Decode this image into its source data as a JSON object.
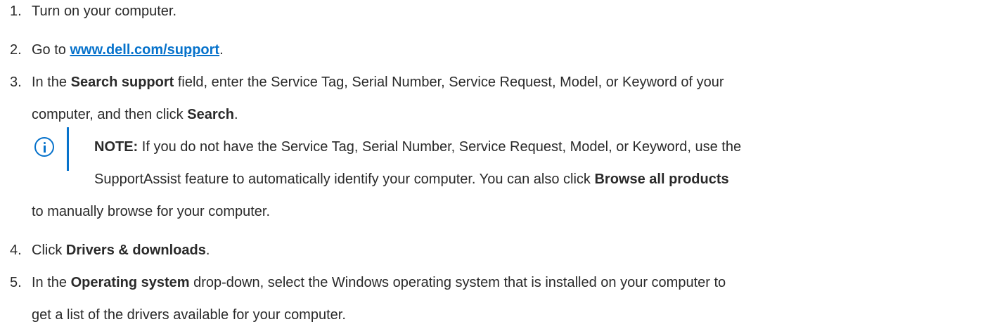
{
  "steps": [
    {
      "num": "1.",
      "text": "Turn on your computer."
    },
    {
      "num": "2.",
      "pre": "Go to ",
      "link": "www.dell.com/support",
      "post": "."
    },
    {
      "num": "3.",
      "pre": "In the ",
      "bold": "Search support",
      "post": " field, enter the Service Tag, Serial Number, Service Request, Model, or Keyword of your",
      "cont_pre": "computer, and then click ",
      "cont_bold": "Search",
      "cont_post": "."
    },
    {
      "num": "4.",
      "pre": "Click ",
      "bold": "Drivers & downloads",
      "post": "."
    },
    {
      "num": "5.",
      "pre": "In the ",
      "bold": "Operating system",
      "post": " drop-down, select the Windows operating system that is installed on your computer to",
      "cont": "get a list of the drivers available for your computer."
    }
  ],
  "note": {
    "icon": "info-icon",
    "label": "NOTE:",
    "line1": " If you do not have the Service Tag, Serial Number, Service Request, Model, or Keyword, use the",
    "line2_pre": "SupportAssist feature to automatically identify your computer. You can also click ",
    "line2_bold": "Browse all products",
    "line3": "to manually browse for your computer."
  },
  "colors": {
    "link": "#0672cb",
    "text": "#2a2a2a",
    "note_accent": "#0672cb"
  }
}
